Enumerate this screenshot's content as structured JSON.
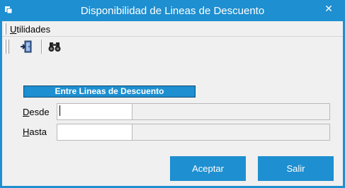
{
  "window": {
    "title": "Disponibilidad de Lineas de Descuento",
    "close_glyph": "✕"
  },
  "menu": {
    "items": [
      {
        "label_first": "U",
        "label_rest": "tilidades"
      }
    ]
  },
  "toolbar": {
    "buttons": [
      {
        "icon": "exit-door-icon"
      },
      {
        "icon": "binoculars-icon"
      }
    ]
  },
  "form": {
    "header": "Entre Lineas de Descuento",
    "desde": {
      "label_first": "D",
      "label_rest": "esde",
      "code_value": "",
      "description_value": ""
    },
    "hasta": {
      "label_first": "H",
      "label_rest": "asta",
      "code_value": "",
      "description_value": ""
    }
  },
  "buttons": {
    "accept": "Aceptar",
    "exit": "Salir"
  },
  "colors": {
    "accent": "#1e8fd0",
    "window_bg": "#f0f0f0"
  }
}
